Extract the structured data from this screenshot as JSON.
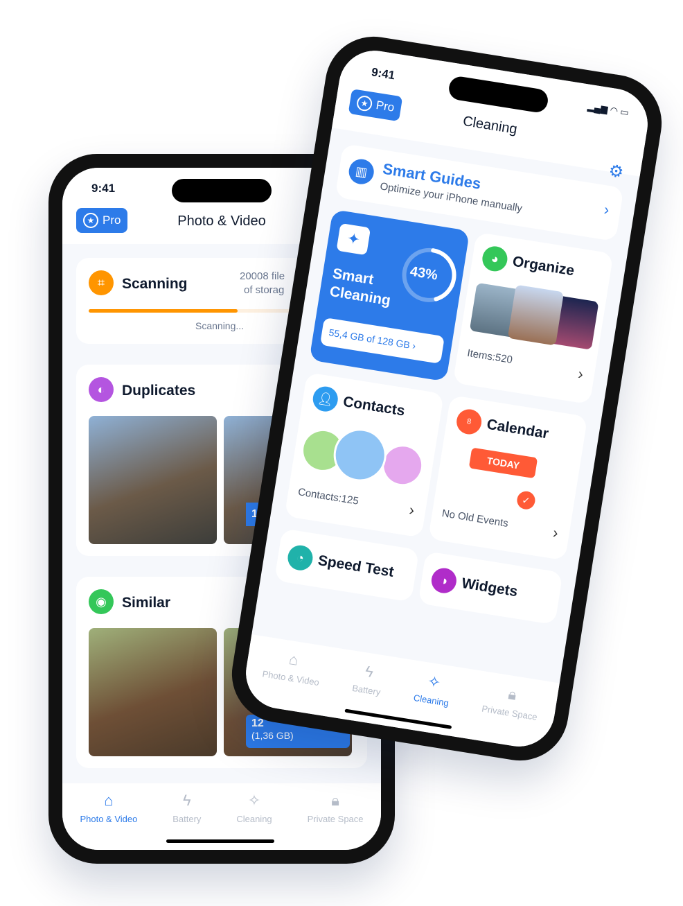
{
  "left": {
    "time": "9:41",
    "pro": "Pro",
    "title": "Photo & Video",
    "scanning": {
      "title": "Scanning",
      "files": "20008 file",
      "storage": "of storag",
      "status": "Scanning...",
      "progress": 0.65,
      "color": "#ff9500"
    },
    "duplicates": {
      "title": "Duplicates",
      "badge": "1"
    },
    "similar": {
      "title": "Similar",
      "badge_count": "12",
      "badge_size": "(1,36 GB)"
    },
    "tabs": [
      {
        "label": "Photo & Video",
        "icon": "home-icon",
        "active": true
      },
      {
        "label": "Battery",
        "icon": "bolt-icon"
      },
      {
        "label": "Cleaning",
        "icon": "sparkle-icon"
      },
      {
        "label": "Private Space",
        "icon": "lock-icon"
      }
    ]
  },
  "right": {
    "time": "9:41",
    "pro": "Pro",
    "title": "Cleaning",
    "guides": {
      "title": "Smart Guides",
      "subtitle": "Optimize your iPhone manually"
    },
    "smart": {
      "title1": "Smart",
      "title2": "Cleaning",
      "percent": "43%",
      "percent_value": 43,
      "storage": "55,4 GB of 128 GB"
    },
    "organize": {
      "title": "Organize",
      "items": "Items:520"
    },
    "contacts": {
      "title": "Contacts",
      "count": "Contacts:125"
    },
    "calendar": {
      "title": "Calendar",
      "today": "TODAY",
      "status": "No Old Events",
      "day": "8"
    },
    "speed": {
      "title": "Speed Test"
    },
    "widgets": {
      "title": "Widgets"
    },
    "tabs": [
      {
        "label": "Photo & Video",
        "icon": "home-icon"
      },
      {
        "label": "Battery",
        "icon": "bolt-icon"
      },
      {
        "label": "Cleaning",
        "icon": "sparkle-icon",
        "active": true
      },
      {
        "label": "Private Space",
        "icon": "lock-icon"
      }
    ]
  },
  "colors": {
    "accent": "#2d7be9",
    "orange": "#ff9500"
  }
}
